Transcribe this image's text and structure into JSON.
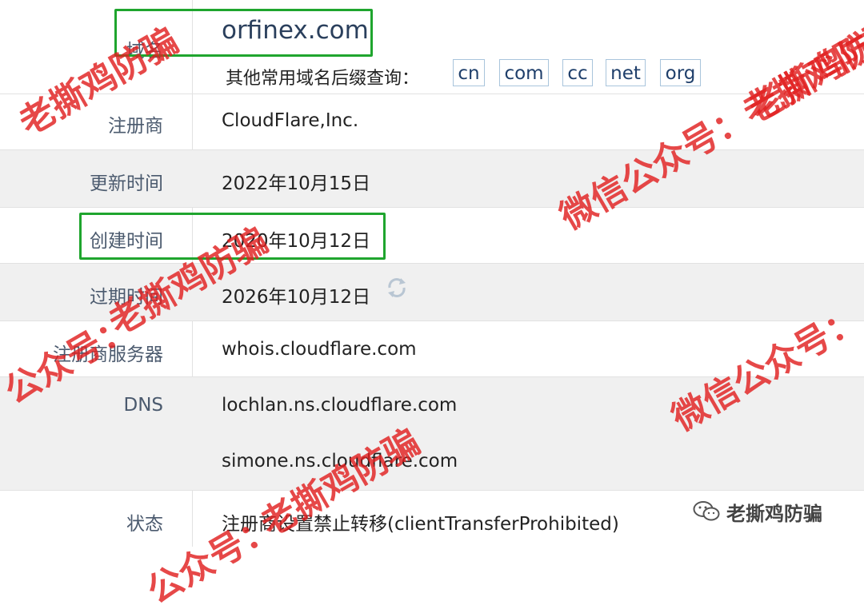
{
  "domain_row": {
    "label": "域名",
    "value": "orfinex.com",
    "suffix_prompt": "其他常用域名后缀查询：",
    "suffixes": [
      "cn",
      "com",
      "cc",
      "net",
      "org"
    ]
  },
  "rows": [
    {
      "label": "注册商",
      "value": "CloudFlare,Inc."
    },
    {
      "label": "更新时间",
      "value": "2022年10月15日"
    },
    {
      "label": "创建时间",
      "value": "2020年10月12日"
    },
    {
      "label": "过期时间",
      "value": "2026年10月12日"
    },
    {
      "label": "注册商服务器",
      "value": "whois.cloudflare.com"
    },
    {
      "label": "DNS",
      "value": "lochlan.ns.cloudflare.com"
    },
    {
      "label": "",
      "value": "simone.ns.cloudflare.com"
    },
    {
      "label": "状态",
      "value": "注册商设置禁止转移(clientTransferProhibited)"
    }
  ],
  "watermarks": [
    "老撕鸡防骗",
    "微信公众号：老撕鸡防骗",
    "微信公众号：",
    "老撕鸡防骗",
    "公众号：",
    "微信公众号：",
    "老撕鸡防骗",
    "公众号："
  ],
  "brand": {
    "icon": "wechat-icon",
    "text": "老撕鸡防骗"
  },
  "colors": {
    "highlight": "#1fa52e",
    "watermark": "#e12020",
    "label": "#4b5a6e",
    "shade": "#f0f0f0"
  }
}
